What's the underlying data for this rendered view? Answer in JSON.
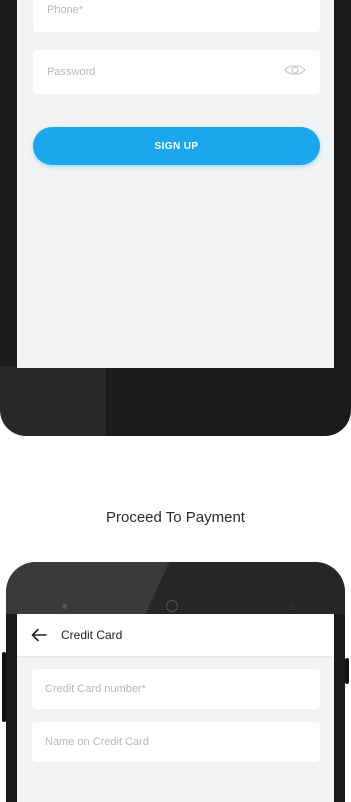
{
  "signup_screen": {
    "phone_placeholder": "Phone*",
    "password_placeholder": "Password",
    "password_toggle_icon": "eye-icon",
    "signup_button": "SIGN UP",
    "accent_color": "#1ba7ee"
  },
  "caption": "Proceed To Payment",
  "payment_screen": {
    "back_icon": "arrow-left-icon",
    "title": "Credit Card",
    "card_number_placeholder": "Credit Card number*",
    "name_on_card_placeholder": "Name on Credit Card"
  }
}
